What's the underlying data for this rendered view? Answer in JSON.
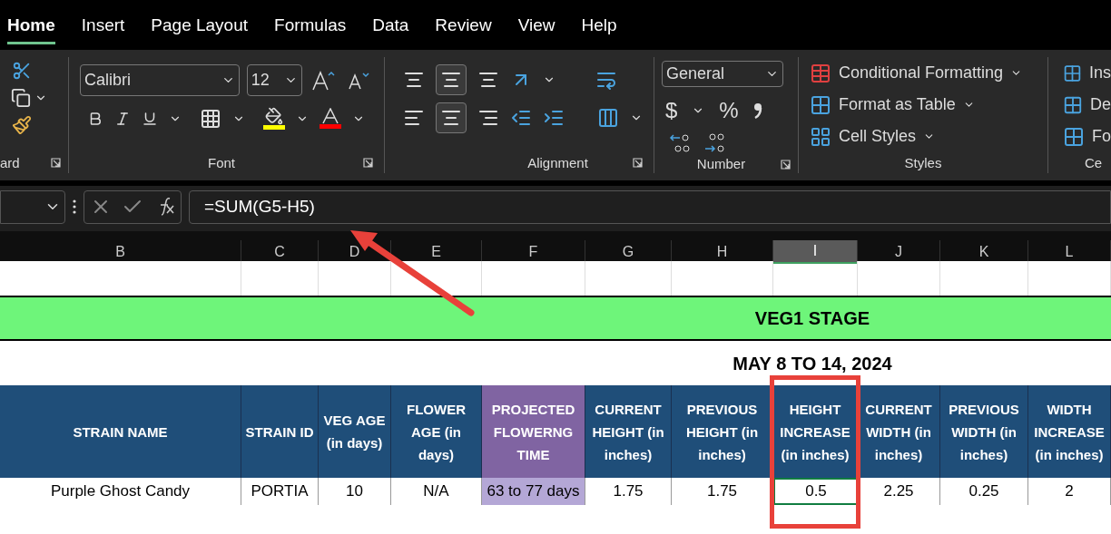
{
  "tabs": [
    {
      "label": "Home",
      "selected": true
    },
    {
      "label": "Insert",
      "selected": false
    },
    {
      "label": "Page Layout",
      "selected": false
    },
    {
      "label": "Formulas",
      "selected": false
    },
    {
      "label": "Data",
      "selected": false
    },
    {
      "label": "Review",
      "selected": false
    },
    {
      "label": "View",
      "selected": false
    },
    {
      "label": "Help",
      "selected": false
    }
  ],
  "ribbon": {
    "clipboard_label": "ard",
    "font_label": "Font",
    "font_name": "Calibri",
    "font_size": "12",
    "alignment_label": "Alignment",
    "number_label": "Number",
    "number_format": "General",
    "currency_symbol": "$",
    "percent_symbol": "%",
    "styles_label": "Styles",
    "styles_buttons": [
      "Conditional Formatting",
      "Format as Table",
      "Cell Styles"
    ],
    "cells_buttons": [
      "Ins",
      "De",
      "Fo"
    ],
    "cells_label": "Ce"
  },
  "formula_bar": {
    "formula": "=SUM(G5-H5)"
  },
  "columns": [
    {
      "label": "B",
      "selected": false
    },
    {
      "label": "C",
      "selected": false
    },
    {
      "label": "D",
      "selected": false
    },
    {
      "label": "E",
      "selected": false
    },
    {
      "label": "F",
      "selected": false
    },
    {
      "label": "G",
      "selected": false
    },
    {
      "label": "H",
      "selected": false
    },
    {
      "label": "I",
      "selected": true
    },
    {
      "label": "J",
      "selected": false
    },
    {
      "label": "K",
      "selected": false
    },
    {
      "label": "L",
      "selected": false
    }
  ],
  "stage_title": "VEG1 STAGE",
  "date_title": "MAY 8 TO 14, 2024",
  "headers": [
    {
      "text": "STRAIN NAME",
      "kind": "plain"
    },
    {
      "text": "STRAIN ID",
      "kind": "plain"
    },
    {
      "text": "VEG AGE (in days)",
      "kind": "plain"
    },
    {
      "text": "FLOWER AGE (in days)",
      "kind": "plain"
    },
    {
      "text": "PROJECTED FLOWERNG TIME",
      "kind": "accent"
    },
    {
      "text": "CURRENT HEIGHT (in inches)",
      "kind": "plain"
    },
    {
      "text": "PREVIOUS HEIGHT (in inches)",
      "kind": "plain"
    },
    {
      "text": "HEIGHT INCREASE (in inches)",
      "kind": "plain"
    },
    {
      "text": "CURRENT WIDTH (in inches)",
      "kind": "plain"
    },
    {
      "text": "PREVIOUS WIDTH (in inches)",
      "kind": "plain"
    },
    {
      "text": "WIDTH INCREASE (in inches)",
      "kind": "plain"
    }
  ],
  "row": [
    {
      "text": "Purple Ghost Candy",
      "kind": "plain",
      "selected": false
    },
    {
      "text": "PORTIA",
      "kind": "plain",
      "selected": false
    },
    {
      "text": "10",
      "kind": "plain",
      "selected": false
    },
    {
      "text": "N/A",
      "kind": "plain",
      "selected": false
    },
    {
      "text": "63 to 77 days",
      "kind": "accent",
      "selected": false
    },
    {
      "text": "1.75",
      "kind": "plain",
      "selected": false
    },
    {
      "text": "1.75",
      "kind": "plain",
      "selected": false
    },
    {
      "text": "0.5",
      "kind": "plain",
      "selected": true
    },
    {
      "text": "2.25",
      "kind": "plain",
      "selected": false
    },
    {
      "text": "0.25",
      "kind": "plain",
      "selected": false
    },
    {
      "text": "2",
      "kind": "plain",
      "selected": false
    }
  ]
}
